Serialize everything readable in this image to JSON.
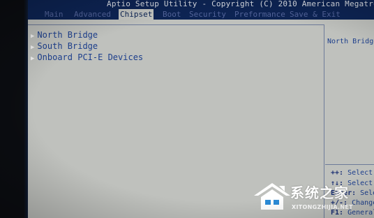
{
  "window": {
    "title": "Aptio Setup Utility - Copyright (C) 2010 American Megatrends, "
  },
  "tabs": [
    {
      "label": "Main"
    },
    {
      "label": "Advanced"
    },
    {
      "label": "Chipset"
    },
    {
      "label": "Boot"
    },
    {
      "label": "Security"
    },
    {
      "label": "Preformance"
    },
    {
      "label": "Save & Exit"
    }
  ],
  "active_tab": "Chipset",
  "menu": {
    "items": [
      {
        "label": "North Bridge"
      },
      {
        "label": "South Bridge"
      },
      {
        "label": "Onboard PCI-E Devices"
      }
    ]
  },
  "help": {
    "text": "North Bridge"
  },
  "keys": [
    {
      "key": "++:",
      "desc": "Select"
    },
    {
      "key": "↑↓:",
      "desc": "Select"
    },
    {
      "key": "Enter:",
      "desc": "Select"
    },
    {
      "key": "+/-:",
      "desc": "Change"
    },
    {
      "key": "F1:",
      "desc": "General"
    }
  ],
  "watermark": {
    "title": "系统之家",
    "url": "XITONGZHIJIA.NET"
  },
  "colors": {
    "bios_blue": "#0d2454",
    "panel_gray": "#bfc1bd",
    "item_blue": "#1c3e8c",
    "tab_inactive": "#53649a"
  },
  "icons": {
    "menu_arrow": "triangle-right-icon",
    "watermark_logo": "house-logo-icon"
  }
}
